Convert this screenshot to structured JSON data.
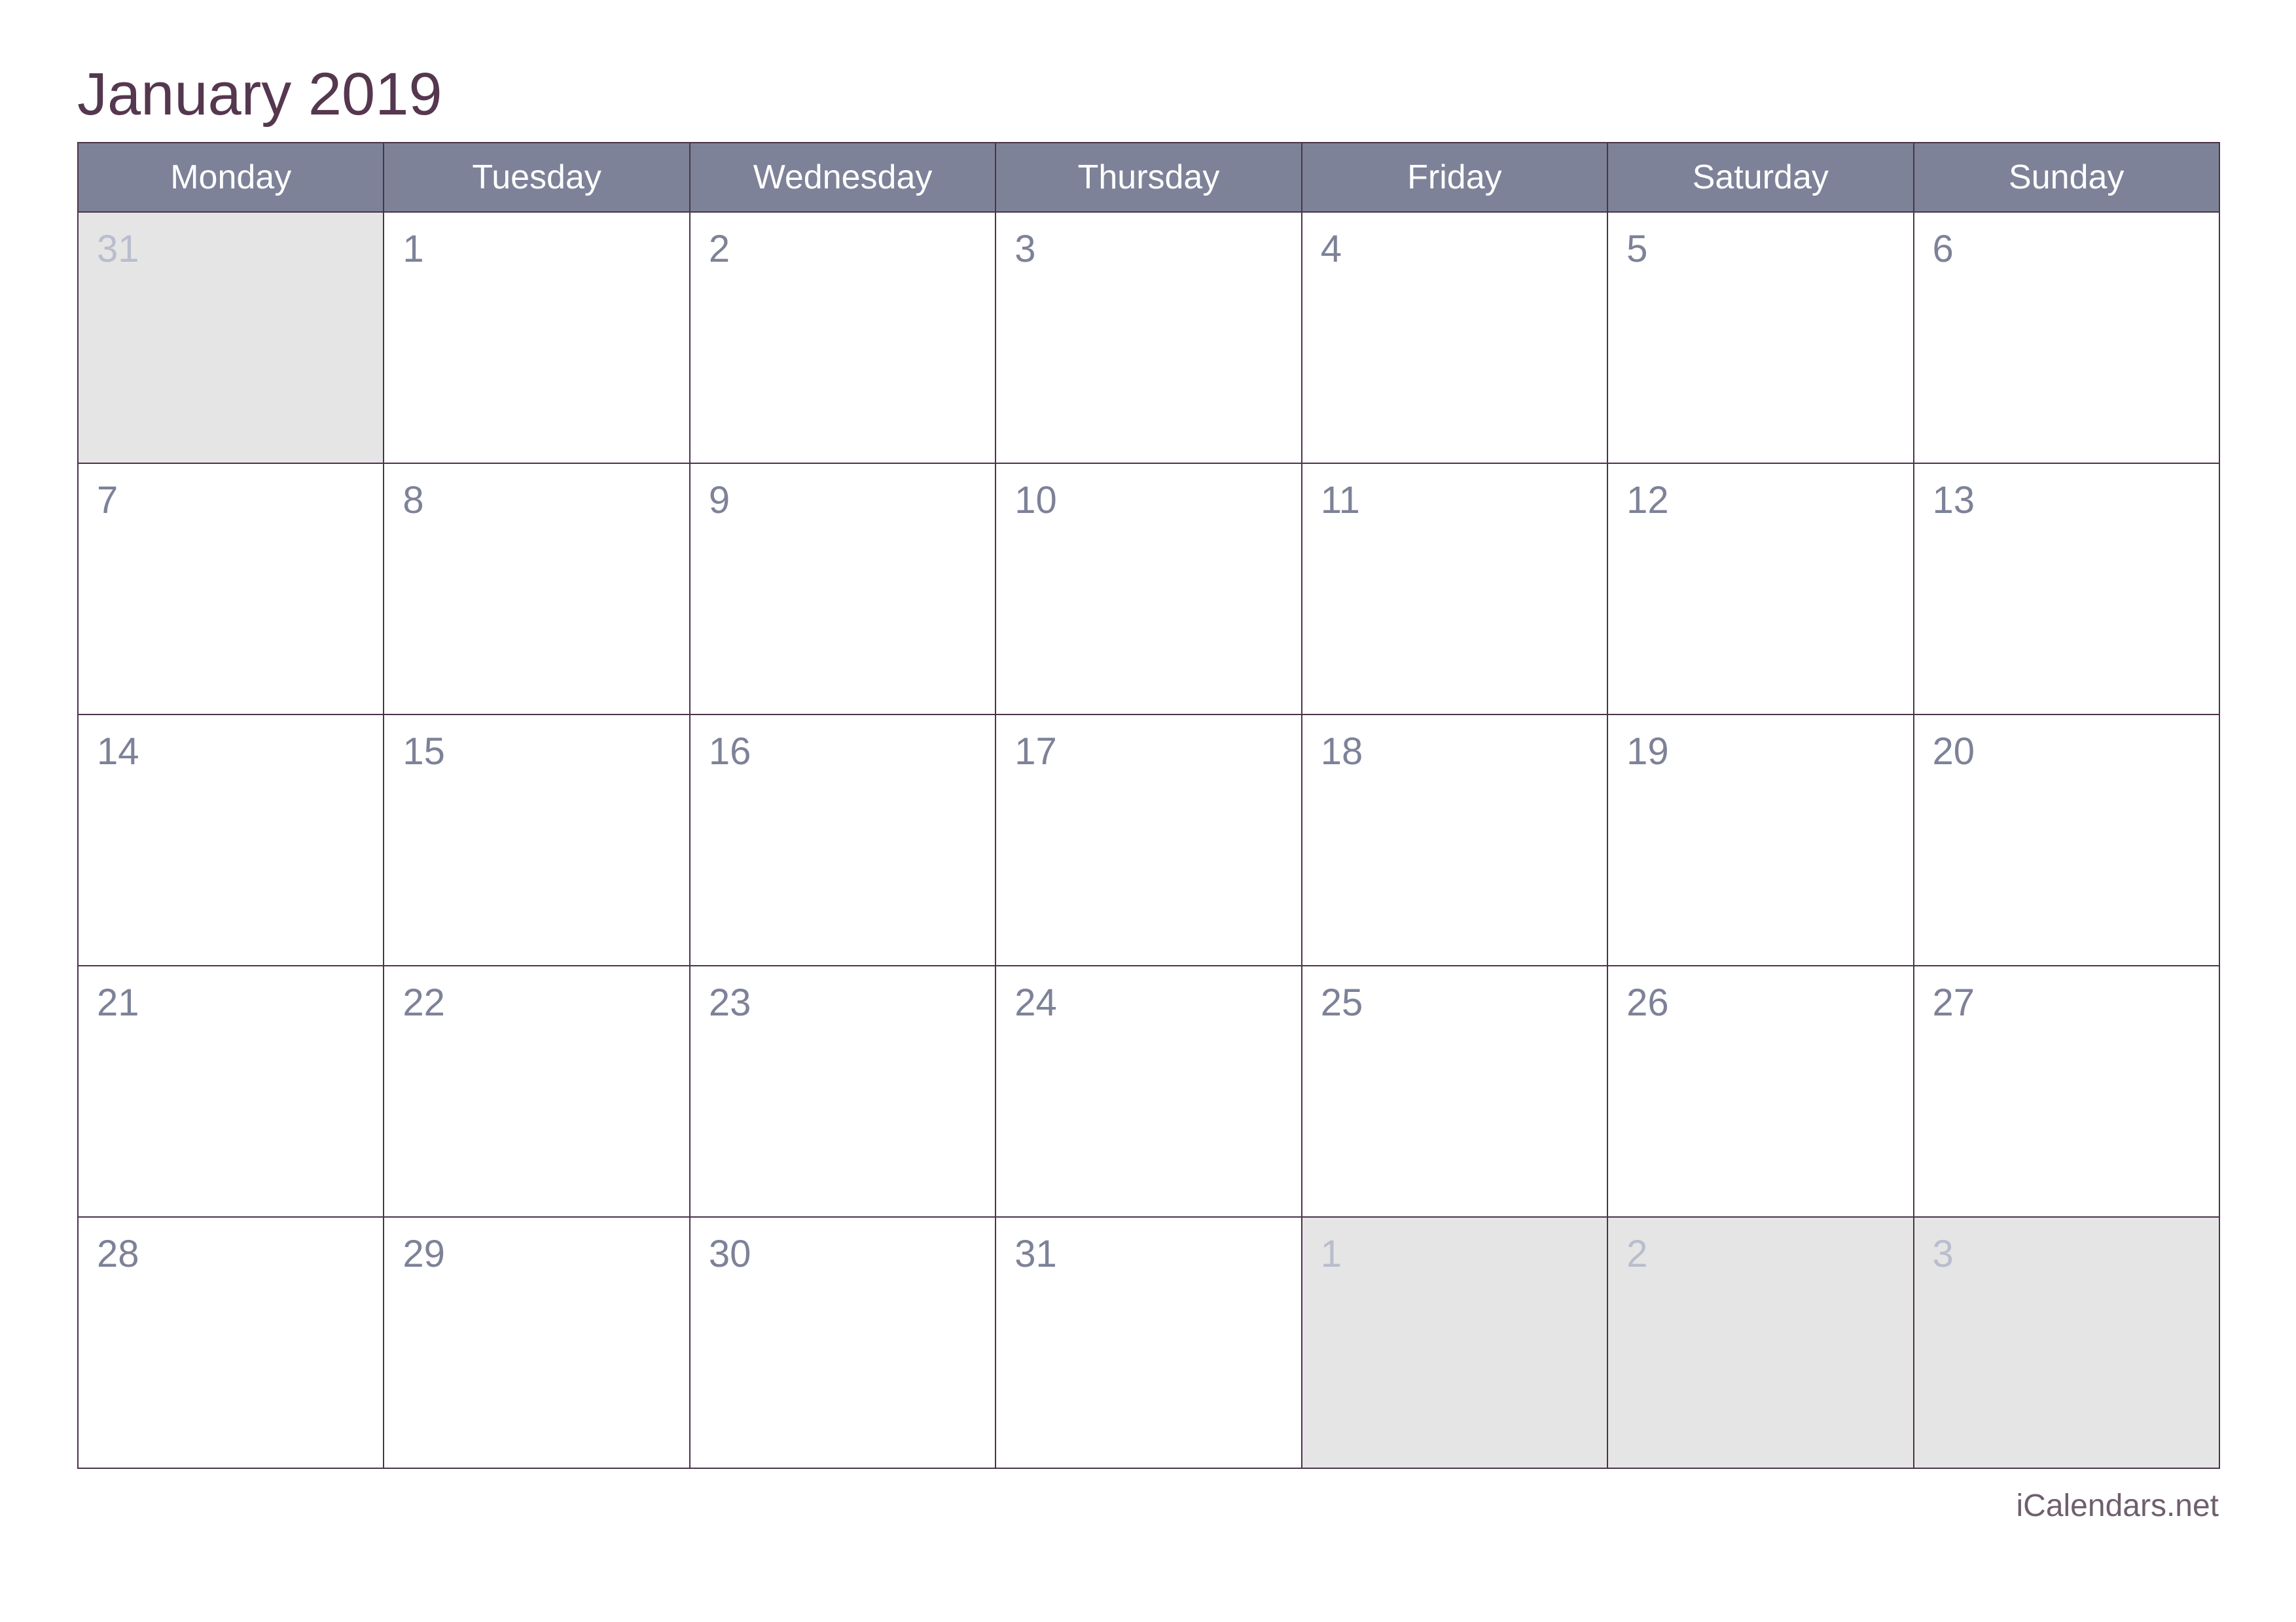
{
  "title": "January 2019",
  "month": "January",
  "year": "2019",
  "colors": {
    "title": "#55374f",
    "header_bg": "#7d8298",
    "header_text": "#ffffff",
    "grid_border": "#4a3449",
    "day_number": "#7d8298",
    "adjacent_day_number": "#b9bdcd",
    "adjacent_day_bg": "#e5e5e5",
    "day_bg": "#ffffff",
    "watermark": "#6f5f6d"
  },
  "weekdays": [
    "Monday",
    "Tuesday",
    "Wednesday",
    "Thursday",
    "Friday",
    "Saturday",
    "Sunday"
  ],
  "weeks": [
    [
      {
        "num": "31",
        "current_month": false
      },
      {
        "num": "1",
        "current_month": true
      },
      {
        "num": "2",
        "current_month": true
      },
      {
        "num": "3",
        "current_month": true
      },
      {
        "num": "4",
        "current_month": true
      },
      {
        "num": "5",
        "current_month": true
      },
      {
        "num": "6",
        "current_month": true
      }
    ],
    [
      {
        "num": "7",
        "current_month": true
      },
      {
        "num": "8",
        "current_month": true
      },
      {
        "num": "9",
        "current_month": true
      },
      {
        "num": "10",
        "current_month": true
      },
      {
        "num": "11",
        "current_month": true
      },
      {
        "num": "12",
        "current_month": true
      },
      {
        "num": "13",
        "current_month": true
      }
    ],
    [
      {
        "num": "14",
        "current_month": true
      },
      {
        "num": "15",
        "current_month": true
      },
      {
        "num": "16",
        "current_month": true
      },
      {
        "num": "17",
        "current_month": true
      },
      {
        "num": "18",
        "current_month": true
      },
      {
        "num": "19",
        "current_month": true
      },
      {
        "num": "20",
        "current_month": true
      }
    ],
    [
      {
        "num": "21",
        "current_month": true
      },
      {
        "num": "22",
        "current_month": true
      },
      {
        "num": "23",
        "current_month": true
      },
      {
        "num": "24",
        "current_month": true
      },
      {
        "num": "25",
        "current_month": true
      },
      {
        "num": "26",
        "current_month": true
      },
      {
        "num": "27",
        "current_month": true
      }
    ],
    [
      {
        "num": "28",
        "current_month": true
      },
      {
        "num": "29",
        "current_month": true
      },
      {
        "num": "30",
        "current_month": true
      },
      {
        "num": "31",
        "current_month": true
      },
      {
        "num": "1",
        "current_month": false
      },
      {
        "num": "2",
        "current_month": false
      },
      {
        "num": "3",
        "current_month": false
      }
    ]
  ],
  "watermark": "iCalendars.net"
}
